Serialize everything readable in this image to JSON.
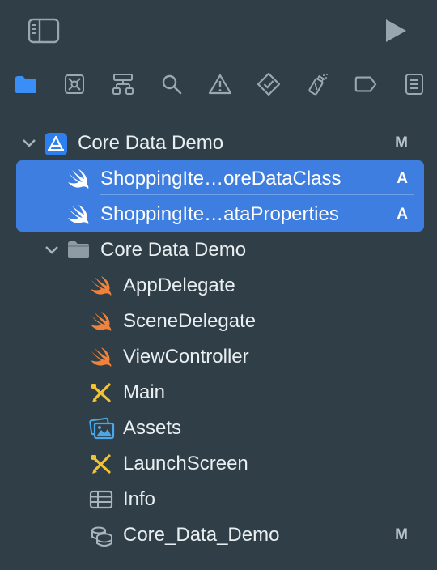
{
  "icons": {
    "sidebar_toggle": "sidebar-toggle-icon",
    "run": "play-icon",
    "project_navigator": "folder-icon",
    "source_control_navigator": "source-control-icon",
    "symbol_navigator": "hierarchy-icon",
    "find_navigator": "magnifier-icon",
    "issue_navigator": "warning-icon",
    "test_navigator": "diamond-check-icon",
    "debug_navigator": "spray-icon",
    "breakpoint_navigator": "tag-icon",
    "report_navigator": "list-icon"
  },
  "colors": {
    "background": "#2f3e47",
    "selection": "#3d7ee0",
    "active_tab": "#3b8ef5",
    "swift_orange": "#f0823b"
  },
  "tree": {
    "project": {
      "label": "Core Data Demo",
      "badge": "M"
    },
    "selected_files": [
      {
        "label": "ShoppingIte…oreDataClass",
        "badge": "A"
      },
      {
        "label": "ShoppingIte…ataProperties",
        "badge": "A"
      }
    ],
    "group": {
      "label": "Core Data Demo"
    },
    "files": [
      {
        "label": "AppDelegate",
        "badge": ""
      },
      {
        "label": "SceneDelegate",
        "badge": ""
      },
      {
        "label": "ViewController",
        "badge": ""
      },
      {
        "label": "Main",
        "badge": ""
      },
      {
        "label": "Assets",
        "badge": ""
      },
      {
        "label": "LaunchScreen",
        "badge": ""
      },
      {
        "label": "Info",
        "badge": ""
      },
      {
        "label": "Core_Data_Demo",
        "badge": "M"
      }
    ]
  }
}
